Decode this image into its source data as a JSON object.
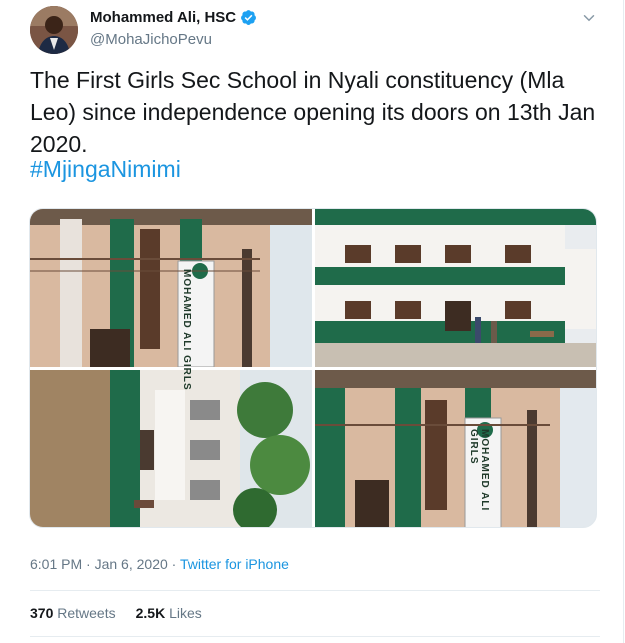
{
  "tweet": {
    "display_name": "Mohammed Ali, HSC",
    "handle": "@MohaJichoPevu",
    "text": "The First Girls Sec School in Nyali constituency (Mla Leo) since independence opening its doors on 13th Jan 2020.",
    "hashtag": "#MjingaNimimi",
    "time": "6:01 PM",
    "date": "Jan 6, 2020",
    "sep": " · ",
    "source": "Twitter for iPhone",
    "retweets": "370",
    "retweets_label": "Retweets",
    "likes": "2.5K",
    "likes_label": "Likes",
    "banner_text": "MOHAMED ALI GIRLS"
  },
  "icons": {
    "verified": "verified-badge-icon",
    "caret": "chevron-down-icon"
  },
  "colors": {
    "link": "#1b95e0",
    "muted": "#657786",
    "text": "#14171a",
    "building_green": "#1f6b4a"
  }
}
